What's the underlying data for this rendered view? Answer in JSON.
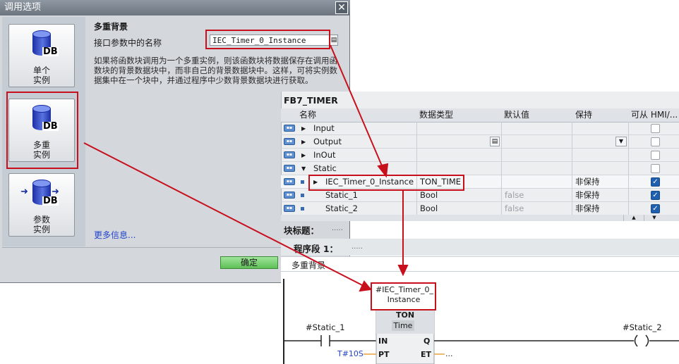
{
  "dialog": {
    "title": "调用选项",
    "close_glyph": "✕",
    "options": [
      {
        "label_line1": "单个",
        "label_line2": "实例",
        "icon": "db-icon"
      },
      {
        "label_line1": "多重",
        "label_line2": "实例",
        "icon": "db-icon"
      },
      {
        "label_line1": "参数",
        "label_line2": "实例",
        "icon": "db-param-icon"
      }
    ],
    "db_text": "DB",
    "heading": "多重背景",
    "name_label": "接口参数中的名称",
    "instance_name": "IEC_Timer_0_Instance",
    "description": "如果将函数块调用为一个多重实例，则该函数块将数据保存在调用函数块的背景数据块中，而非自己的背景数据块中。这样，可将实例数据集中在一个块中，并通过程序中少数背景数据块进行获取。",
    "more_info": "更多信息...",
    "ok_label": "确定"
  },
  "fb": {
    "title": "FB7_TIMER",
    "headers": {
      "name": "名称",
      "datatype": "数据类型",
      "default": "默认值",
      "retain": "保持",
      "hmi": "可从 HMI/..."
    },
    "rows": [
      {
        "name": "Input",
        "datatype": "",
        "default": "",
        "retain": "",
        "hmi": false
      },
      {
        "name": "Output",
        "datatype": "",
        "default": "",
        "retain": "",
        "hmi": false
      },
      {
        "name": "InOut",
        "datatype": "",
        "default": "",
        "retain": "",
        "hmi": false
      },
      {
        "name": "Static",
        "datatype": "",
        "default": "",
        "retain": "",
        "hmi": false
      },
      {
        "name": "IEC_Timer_0_Instance",
        "datatype": "TON_TIME",
        "default": "",
        "retain": "非保持",
        "hmi": true
      },
      {
        "name": "Static_1",
        "datatype": "Bool",
        "default": "false",
        "retain": "非保持",
        "hmi": true
      },
      {
        "name": "Static_2",
        "datatype": "Bool",
        "default": "false",
        "retain": "非保持",
        "hmi": true
      }
    ]
  },
  "block": {
    "title_label": "块标题：",
    "title_value": ".....",
    "network_label": "程序段 1：",
    "network_value": ".....",
    "network_comment": "多重背景"
  },
  "ladder": {
    "instance_line1": "#IEC_Timer_0_",
    "instance_line2": "Instance",
    "box_type": "TON",
    "box_subtype": "Time",
    "contact_tag": "#Static_1",
    "coil_tag": "#Static_2",
    "pin_in": "IN",
    "pin_pt": "PT",
    "pin_q": "Q",
    "pin_et": "ET",
    "pt_value": "T#10S",
    "et_value": "...",
    "coil_glyph": "( )"
  },
  "colors": {
    "highlight": "#c8101d",
    "ok_button": "#5fbf57",
    "link": "#2244cc"
  }
}
